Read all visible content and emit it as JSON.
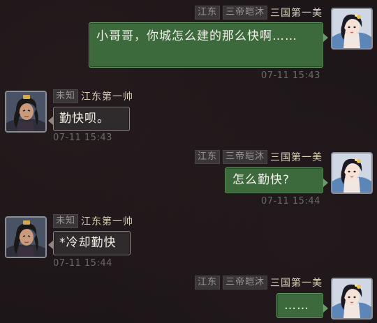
{
  "messages": [
    {
      "side": "right",
      "tags": [
        "江东",
        "三帝皑沐"
      ],
      "player_name": "三国第一美",
      "avatar": "female-portrait-avatar",
      "text": "小哥哥，你城怎么建的那么快啊……",
      "time": "07-11 15:43"
    },
    {
      "side": "left",
      "tags": [
        "未知"
      ],
      "player_name": "江东第一帅",
      "avatar": "male-portrait-avatar",
      "text": "勤快呗。",
      "time": "07-11 15:43"
    },
    {
      "side": "right",
      "tags": [
        "江东",
        "三帝皑沐"
      ],
      "player_name": "三国第一美",
      "avatar": "female-portrait-avatar",
      "text": "怎么勤快?",
      "time": "07-11 15:44"
    },
    {
      "side": "left",
      "tags": [
        "未知"
      ],
      "player_name": "江东第一帅",
      "avatar": "male-portrait-avatar",
      "text": "*冷却勤快",
      "time": "07-11 15:44"
    },
    {
      "side": "right",
      "tags": [
        "江东",
        "三帝皑沐"
      ],
      "player_name": "三国第一美",
      "avatar": "female-portrait-avatar",
      "text": "……",
      "time": ""
    }
  ],
  "colors": {
    "background": "#1d1618",
    "own_bubble": "#3c6a3d",
    "other_bubble": "#2f2a2c",
    "name": "#d8cfb8",
    "timestamp": "#6b6a6a"
  }
}
